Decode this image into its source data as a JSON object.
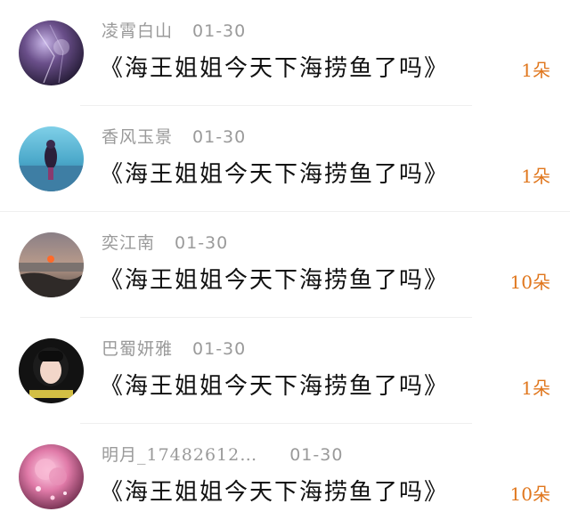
{
  "colors": {
    "accent": "#e0761c",
    "meta_text": "#9a9a9a",
    "title_text": "#111111"
  },
  "items": [
    {
      "name": "凌霄白山",
      "date": "01-30",
      "title": "《海王姐姐今天下海捞鱼了吗》",
      "count": "1朵",
      "avatar": "purple-night-avatar"
    },
    {
      "name": "香风玉景",
      "date": "01-30",
      "title": "《海王姐姐今天下海捞鱼了吗》",
      "count": "1朵",
      "avatar": "girl-by-lake-avatar"
    },
    {
      "name": "奕江南",
      "date": "01-30",
      "title": "《海王姐姐今天下海捞鱼了吗》",
      "count": "10朵",
      "avatar": "sunset-sea-avatar"
    },
    {
      "name": "巴蜀妍雅",
      "date": "01-30",
      "title": "《海王姐姐今天下海捞鱼了吗》",
      "count": "1朵",
      "avatar": "girl-portrait-avatar"
    },
    {
      "name": "明月_17482612…",
      "date": "01-30",
      "title": "《海王姐姐今天下海捞鱼了吗》",
      "count": "10朵",
      "avatar": "pink-flower-avatar"
    }
  ]
}
